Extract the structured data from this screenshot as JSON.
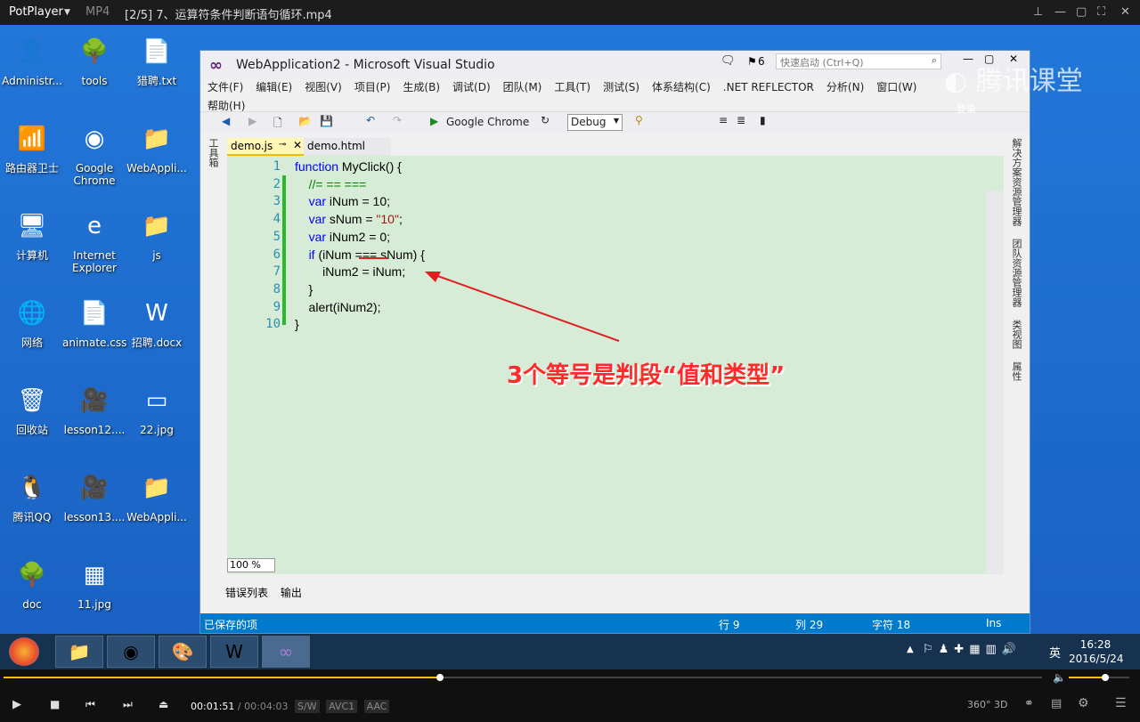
{
  "player": {
    "app_name": "PotPlayer",
    "format": "MP4",
    "file_title": "[2/5] 7、运算符条件判断语句循环.mp4",
    "time_current": "00:01:51",
    "time_sep": "/",
    "time_total": "00:04:03",
    "sw_label": "S/W",
    "codec_video": "AVC1",
    "codec_audio": "AAC",
    "btn_360": "360°",
    "btn_3d": "3D",
    "progress_fraction": 0.42,
    "volume_fraction": 0.6,
    "watermark": "腾讯课堂",
    "watermark_sub": "登录"
  },
  "desktop": {
    "icons": [
      {
        "label": "Administr...",
        "glyph": "👤"
      },
      {
        "label": "tools",
        "glyph": "🌳"
      },
      {
        "label": "猎聘.txt",
        "glyph": "📄"
      },
      {
        "label": "路由器卫士",
        "glyph": "📶"
      },
      {
        "label": "Google Chrome",
        "glyph": "◉"
      },
      {
        "label": "WebAppli...",
        "glyph": "📁"
      },
      {
        "label": "计算机",
        "glyph": "🖥"
      },
      {
        "label": "Internet Explorer",
        "glyph": "e"
      },
      {
        "label": "js",
        "glyph": "📁"
      },
      {
        "label": "网络",
        "glyph": "🌐"
      },
      {
        "label": "animate.css",
        "glyph": "📄"
      },
      {
        "label": "招聘.docx",
        "glyph": "W"
      },
      {
        "label": "回收站",
        "glyph": "🗑"
      },
      {
        "label": "lesson12....",
        "glyph": "🎥"
      },
      {
        "label": "22.jpg",
        "glyph": "▭"
      },
      {
        "label": "腾讯QQ",
        "glyph": "🐧"
      },
      {
        "label": "lesson13....",
        "glyph": "🎥"
      },
      {
        "label": "WebAppli...",
        "glyph": "📁"
      },
      {
        "label": "doc",
        "glyph": "🌳"
      },
      {
        "label": "11.jpg",
        "glyph": "▦"
      }
    ]
  },
  "vs": {
    "title": "WebApplication2 - Microsoft Visual Studio",
    "notif_count": "6",
    "quick_launch_placeholder": "快速启动 (Ctrl+Q)",
    "menu": [
      "文件(F)",
      "编辑(E)",
      "视图(V)",
      "项目(P)",
      "生成(B)",
      "调试(D)",
      "团队(M)",
      "工具(T)",
      "测试(S)",
      "体系结构(C)",
      ".NET REFLECTOR",
      "分析(N)",
      "窗口(W)"
    ],
    "menu_help": "帮助(H)",
    "run_target": "Google Chrome",
    "config": "Debug",
    "toolbox_label": "工具箱",
    "tab_active": "demo.js",
    "tab_other": "demo.html",
    "right_panels": [
      "解决方案资源管理器",
      "团队资源管理器",
      "类视图",
      "属性"
    ],
    "zoom": "100 %",
    "bottom_tabs": [
      "错误列表",
      "输出"
    ],
    "status_saved": "已保存的项",
    "status_row": "行 9",
    "status_col": "列 29",
    "status_char": "字符 18",
    "status_ins": "Ins",
    "lines": [
      {
        "n": "1",
        "html": "<span class=\"kw\">function</span> MyClick() {"
      },
      {
        "n": "2",
        "html": "    <span class=\"cm\">//= == ===</span>"
      },
      {
        "n": "3",
        "html": "    <span class=\"kw\">var</span> iNum = 10;"
      },
      {
        "n": "4",
        "html": "    <span class=\"kw\">var</span> sNum = <span class=\"str\">\"10\"</span>;"
      },
      {
        "n": "5",
        "html": "    <span class=\"kw\">var</span> iNum2 = 0;"
      },
      {
        "n": "6",
        "html": "    <span class=\"kw\">if</span> (iNum === sNum) {"
      },
      {
        "n": "7",
        "html": "        iNum2 = iNum;"
      },
      {
        "n": "8",
        "html": "    }"
      },
      {
        "n": "9",
        "html": "    alert(iNum2);"
      },
      {
        "n": "10",
        "html": "}"
      }
    ],
    "annotation": "3个等号是判段“值和类型”"
  },
  "taskbar": {
    "clock_time": "16:28",
    "clock_date": "2016/5/24",
    "ime": "英"
  }
}
